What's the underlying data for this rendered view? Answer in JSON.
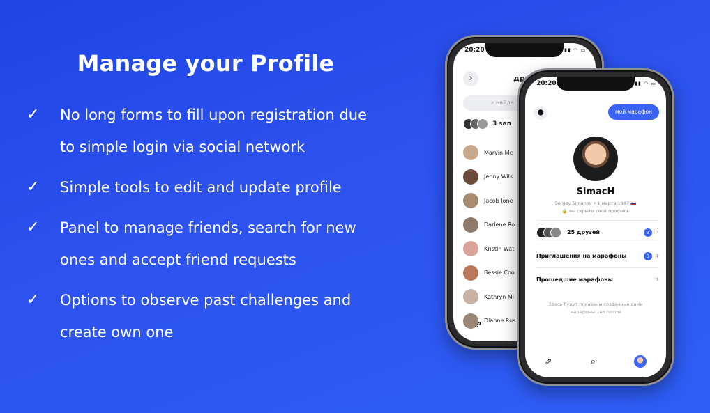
{
  "slide": {
    "title": "Manage your Profile",
    "check_glyph": "✓",
    "features": [
      {
        "lines": [
          "No long forms to fill upon registration due",
          "to simple login via social network"
        ]
      },
      {
        "lines": [
          "Simple tools to edit and update profile"
        ]
      },
      {
        "lines": [
          "Panel to manage friends, search for new",
          "ones and accept friend requests"
        ]
      },
      {
        "lines": [
          "Options to observe past challenges and",
          "create own one"
        ]
      }
    ]
  },
  "back_phone": {
    "time": "20:20",
    "title": "друзь",
    "search_placeholder": "найде",
    "requests_label": "3 зап",
    "friends": [
      {
        "name": "Marvin Mc",
        "color": "#c9a98c"
      },
      {
        "name": "Jenny Wils",
        "color": "#6b4a3a"
      },
      {
        "name": "Jacob Jone",
        "color": "#a78c74"
      },
      {
        "name": "Darlene Ro",
        "color": "#8e7a6b"
      },
      {
        "name": "Kristin Wat",
        "color": "#d9a39a"
      },
      {
        "name": "Bessie Coo",
        "color": "#b9785a"
      },
      {
        "name": "Kathryn Mi",
        "color": "#c7b2a3"
      },
      {
        "name": "Dianne Rus",
        "color": "#9a8677"
      }
    ],
    "bottom_icon": "share-icon"
  },
  "front_phone": {
    "time": "20:20",
    "my_marathon_button": "мой марафон",
    "nickname": "SimacH",
    "subline": "Sergey Simanov • 1 марта 1987 🇷🇺",
    "privacy": "🔒 вы скрыли свой профиль",
    "friends_row": {
      "label": "25 друзей",
      "badge": "3"
    },
    "invites_row": {
      "label": "Приглашения на марафоны",
      "badge": "3"
    },
    "past_row": {
      "label": "Прошедшие марафоны"
    },
    "empty_note": "Здесь будут показаны созданные вами марафоны...но потом",
    "tabs": [
      "share-icon",
      "search-icon",
      "avatar"
    ]
  },
  "colors": {
    "accent": "#3a63f5",
    "background": "#2b50ee"
  }
}
